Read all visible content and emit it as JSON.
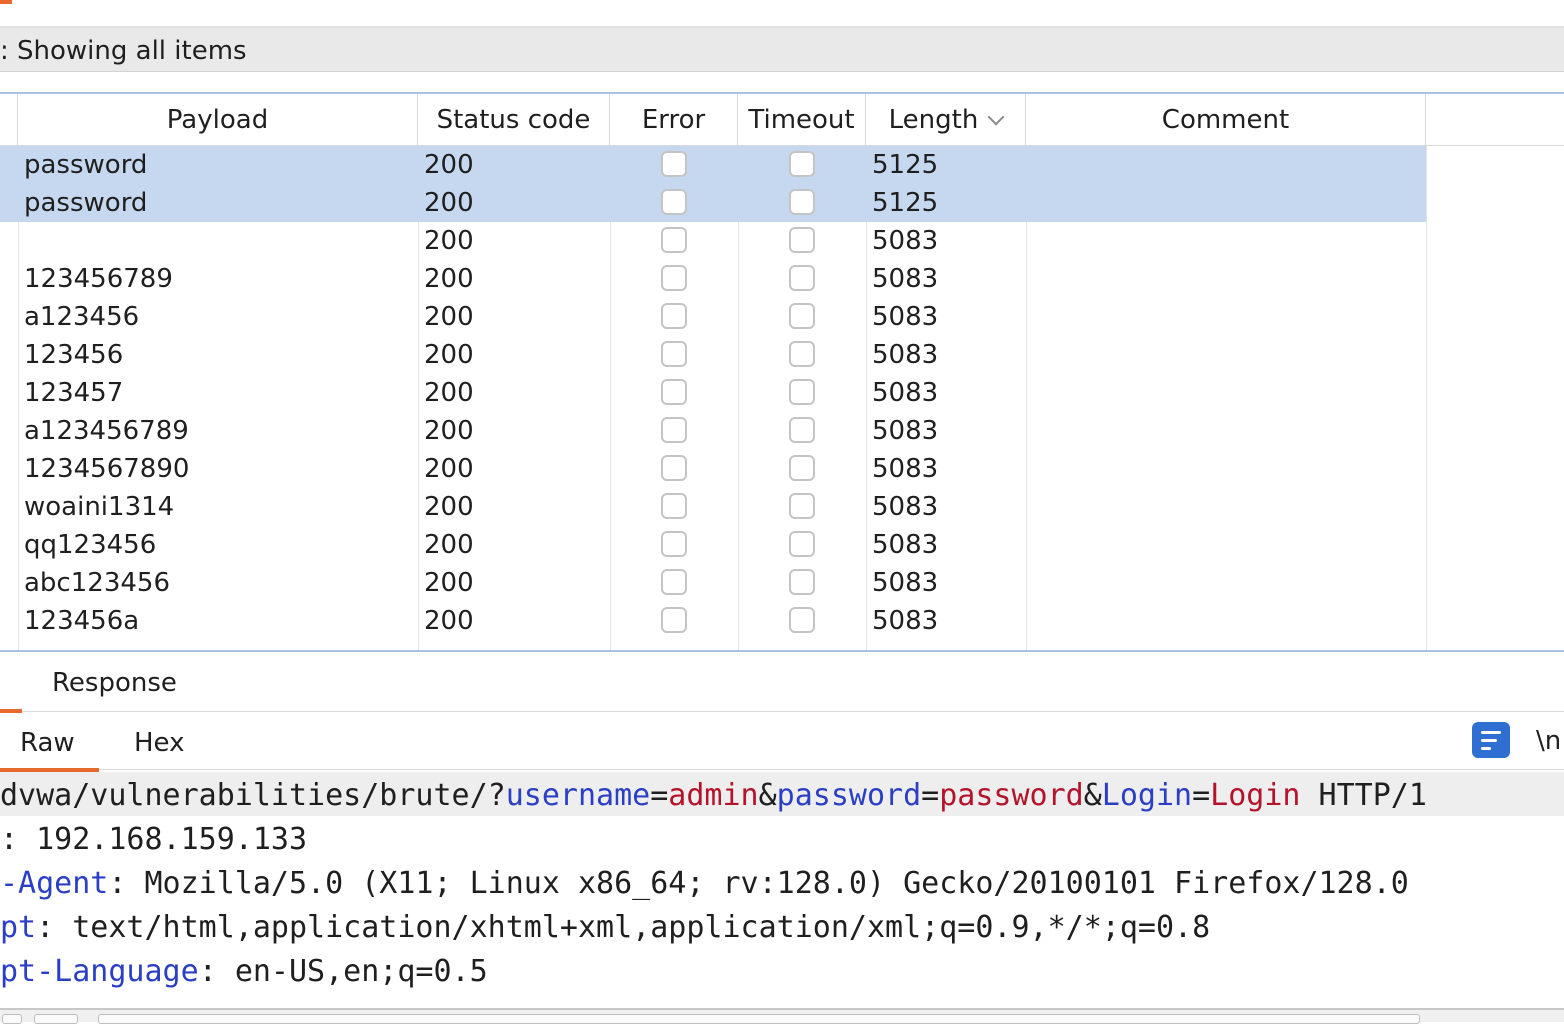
{
  "filter": {
    "text": ": Showing all items"
  },
  "table": {
    "columns": [
      "Payload",
      "Status code",
      "Error",
      "Timeout",
      "Length",
      "Comment"
    ],
    "rows": [
      {
        "payload": "password",
        "status": "200",
        "length": "5125",
        "selected": true
      },
      {
        "payload": "password",
        "status": "200",
        "length": "5125",
        "selected": true
      },
      {
        "payload": "",
        "status": "200",
        "length": "5083",
        "selected": false
      },
      {
        "payload": "123456789",
        "status": "200",
        "length": "5083",
        "selected": false
      },
      {
        "payload": "a123456",
        "status": "200",
        "length": "5083",
        "selected": false
      },
      {
        "payload": "123456",
        "status": "200",
        "length": "5083",
        "selected": false
      },
      {
        "payload": "123457",
        "status": "200",
        "length": "5083",
        "selected": false
      },
      {
        "payload": "a123456789",
        "status": "200",
        "length": "5083",
        "selected": false
      },
      {
        "payload": "1234567890",
        "status": "200",
        "length": "5083",
        "selected": false
      },
      {
        "payload": "woaini1314",
        "status": "200",
        "length": "5083",
        "selected": false
      },
      {
        "payload": "qq123456",
        "status": "200",
        "length": "5083",
        "selected": false
      },
      {
        "payload": "abc123456",
        "status": "200",
        "length": "5083",
        "selected": false
      },
      {
        "payload": "123456a",
        "status": "200",
        "length": "5083",
        "selected": false
      }
    ]
  },
  "response": {
    "tab_label": "Response",
    "subtabs": [
      "Raw",
      "Hex"
    ],
    "newline_label": "\\n"
  },
  "request": {
    "line1": {
      "prefix": "dvwa/vulnerabilities/brute/?",
      "k1": "username",
      "eq1": "=",
      "v1": "admin",
      "amp1": "&",
      "k2": "password",
      "eq2": "=",
      "v2": "password",
      "amp2": "&",
      "k3": "Login",
      "eq3": "=",
      "v3": "Login",
      "suffix": " HTTP/1"
    },
    "line2": {
      "key": "",
      "sep": ": ",
      "value": "192.168.159.133"
    },
    "line3": {
      "key": "-Agent",
      "sep": ": ",
      "value": "Mozilla/5.0 (X11; Linux x86_64; rv:128.0) Gecko/20100101 Firefox/128.0"
    },
    "line4": {
      "key": "pt",
      "sep": ": ",
      "value": "text/html,application/xhtml+xml,application/xml;q=0.9,*/*;q=0.8"
    },
    "line5": {
      "key": "pt-Language",
      "sep": ": ",
      "value": "en-US,en;q=0.5"
    }
  },
  "colors": {
    "accent": "#e8692d",
    "selection": "#c6d8ef",
    "param_key": "#2b3fc4",
    "param_value": "#b3142b",
    "wrap_button": "#2f6fd1"
  }
}
